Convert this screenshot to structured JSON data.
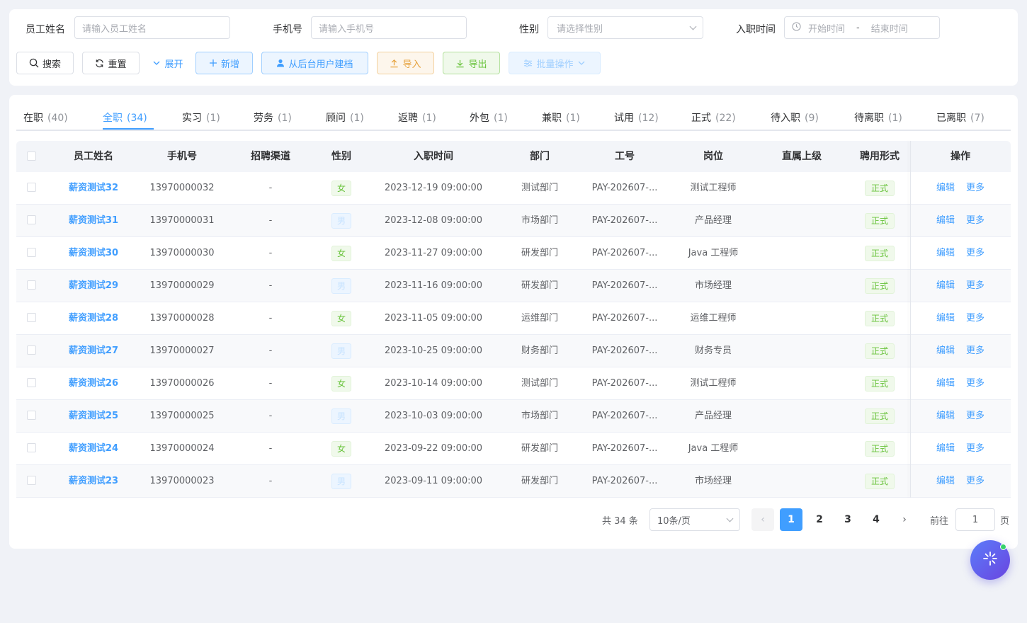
{
  "filters": {
    "name_label": "员工姓名",
    "name_placeholder": "请输入员工姓名",
    "phone_label": "手机号",
    "phone_placeholder": "请输入手机号",
    "gender_label": "性别",
    "gender_placeholder": "请选择性别",
    "hire_label": "入职时间",
    "hire_start": "开始时间",
    "hire_sep": "-",
    "hire_end": "结束时间"
  },
  "toolbar": {
    "search": "搜索",
    "reset": "重置",
    "expand": "展开",
    "add": "新增",
    "from_backend": "从后台用户建档",
    "import": "导入",
    "export": "导出",
    "batch": "批量操作"
  },
  "tabs": [
    {
      "label": "在职",
      "count": "(40)"
    },
    {
      "label": "全职",
      "count": "(34)"
    },
    {
      "label": "实习",
      "count": "(1)"
    },
    {
      "label": "劳务",
      "count": "(1)"
    },
    {
      "label": "顾问",
      "count": "(1)"
    },
    {
      "label": "返聘",
      "count": "(1)"
    },
    {
      "label": "外包",
      "count": "(1)"
    },
    {
      "label": "兼职",
      "count": "(1)"
    },
    {
      "label": "试用",
      "count": "(12)"
    },
    {
      "label": "正式",
      "count": "(22)"
    },
    {
      "label": "待入职",
      "count": "(9)"
    },
    {
      "label": "待离职",
      "count": "(1)"
    },
    {
      "label": "已离职",
      "count": "(7)"
    }
  ],
  "active_tab": 1,
  "columns": [
    "员工姓名",
    "手机号",
    "招聘渠道",
    "性别",
    "入职时间",
    "部门",
    "工号",
    "岗位",
    "直属上级",
    "聘用形式",
    "操作"
  ],
  "rows": [
    {
      "name": "薪资测试32",
      "phone": "13970000032",
      "channel": "-",
      "gender": "女",
      "hire": "2023-12-19 09:00:00",
      "dept": "测试部门",
      "id": "PAY-202607-...",
      "post": "测试工程师",
      "leader": "",
      "type": "正式"
    },
    {
      "name": "薪资测试31",
      "phone": "13970000031",
      "channel": "-",
      "gender": "男",
      "hire": "2023-12-08 09:00:00",
      "dept": "市场部门",
      "id": "PAY-202607-...",
      "post": "产品经理",
      "leader": "",
      "type": "正式"
    },
    {
      "name": "薪资测试30",
      "phone": "13970000030",
      "channel": "-",
      "gender": "女",
      "hire": "2023-11-27 09:00:00",
      "dept": "研发部门",
      "id": "PAY-202607-...",
      "post": "Java 工程师",
      "leader": "",
      "type": "正式"
    },
    {
      "name": "薪资测试29",
      "phone": "13970000029",
      "channel": "-",
      "gender": "男",
      "hire": "2023-11-16 09:00:00",
      "dept": "研发部门",
      "id": "PAY-202607-...",
      "post": "市场经理",
      "leader": "",
      "type": "正式"
    },
    {
      "name": "薪资测试28",
      "phone": "13970000028",
      "channel": "-",
      "gender": "女",
      "hire": "2023-11-05 09:00:00",
      "dept": "运维部门",
      "id": "PAY-202607-...",
      "post": "运维工程师",
      "leader": "",
      "type": "正式"
    },
    {
      "name": "薪资测试27",
      "phone": "13970000027",
      "channel": "-",
      "gender": "男",
      "hire": "2023-10-25 09:00:00",
      "dept": "财务部门",
      "id": "PAY-202607-...",
      "post": "财务专员",
      "leader": "",
      "type": "正式"
    },
    {
      "name": "薪资测试26",
      "phone": "13970000026",
      "channel": "-",
      "gender": "女",
      "hire": "2023-10-14 09:00:00",
      "dept": "测试部门",
      "id": "PAY-202607-...",
      "post": "测试工程师",
      "leader": "",
      "type": "正式"
    },
    {
      "name": "薪资测试25",
      "phone": "13970000025",
      "channel": "-",
      "gender": "男",
      "hire": "2023-10-03 09:00:00",
      "dept": "市场部门",
      "id": "PAY-202607-...",
      "post": "产品经理",
      "leader": "",
      "type": "正式"
    },
    {
      "name": "薪资测试24",
      "phone": "13970000024",
      "channel": "-",
      "gender": "女",
      "hire": "2023-09-22 09:00:00",
      "dept": "研发部门",
      "id": "PAY-202607-...",
      "post": "Java 工程师",
      "leader": "",
      "type": "正式"
    },
    {
      "name": "薪资测试23",
      "phone": "13970000023",
      "channel": "-",
      "gender": "男",
      "hire": "2023-09-11 09:00:00",
      "dept": "研发部门",
      "id": "PAY-202607-...",
      "post": "市场经理",
      "leader": "",
      "type": "正式"
    }
  ],
  "row_actions": {
    "edit": "编辑",
    "more": "更多"
  },
  "pagination": {
    "total": "共 34 条",
    "page_size": "10条/页",
    "pages": [
      "1",
      "2",
      "3",
      "4"
    ],
    "current_page": "1",
    "goto_label": "前往",
    "goto_value": "1",
    "page_suffix": "页"
  },
  "colors": {
    "primary": "#409eff",
    "success": "#67c23a",
    "warning": "#e6a23c"
  }
}
